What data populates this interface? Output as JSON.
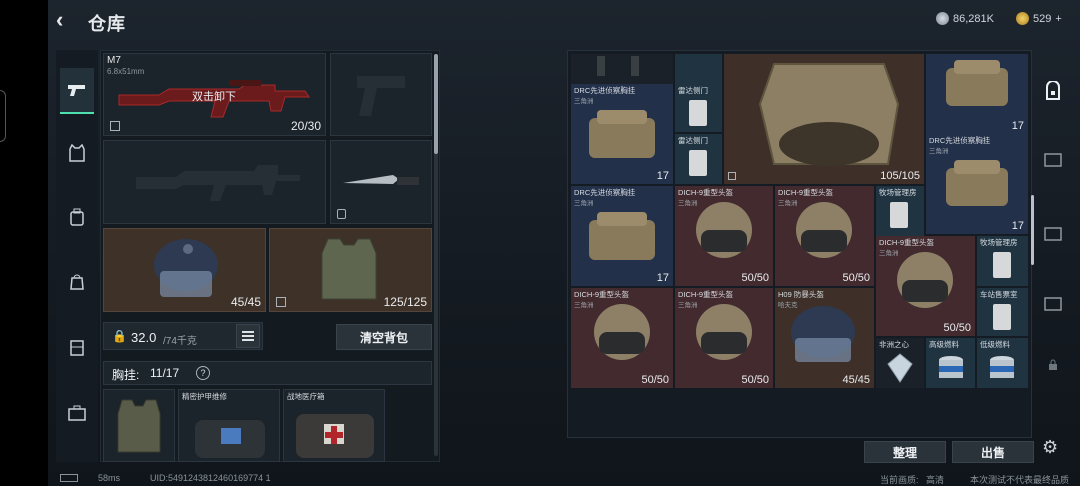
{
  "header": {
    "title": "仓库",
    "currency1": "86,281K",
    "currency2": "529",
    "plus": "+"
  },
  "loadout": {
    "primary": {
      "name": "M7",
      "ammo": "6.8x51mm",
      "action": "双击卸下",
      "count": "20/30"
    },
    "helmet": {
      "count": "45/45"
    },
    "armor": {
      "count": "125/125"
    },
    "weight": {
      "current": "32.0",
      "max": "/74千克"
    },
    "clear_button": "清空背包",
    "rig": {
      "label": "胸挂:",
      "value": "11/17",
      "help": "?"
    },
    "pouch": [
      {
        "name": "",
        "icon": "vest"
      },
      {
        "name": "精密护甲维修",
        "icon": "repair-kit"
      },
      {
        "name": "战地医疗箱",
        "icon": "medkit"
      }
    ]
  },
  "stash": {
    "items": [
      {
        "name": "DRC先进侦察胸挂",
        "sub": "三角洲",
        "qty": "17",
        "type": "bag"
      },
      {
        "name": "雷达侧门",
        "sub": "",
        "qty": "",
        "type": "card"
      },
      {
        "name": "雷达侧门",
        "sub": "",
        "qty": "",
        "type": "card"
      },
      {
        "name": "",
        "sub": "",
        "qty": "105/105",
        "type": "armor"
      },
      {
        "name": "",
        "sub": "",
        "qty": "17",
        "type": "bag"
      },
      {
        "name": "DRC先进侦察胸挂",
        "sub": "三角洲",
        "qty": "17",
        "type": "bag"
      },
      {
        "name": "DRC先进侦察胸挂",
        "sub": "三角洲",
        "qty": "17",
        "type": "bag"
      },
      {
        "name": "DICH-9重型头盔",
        "sub": "三角洲",
        "qty": "50/50",
        "type": "helmet"
      },
      {
        "name": "DICH-9重型头盔",
        "sub": "三角洲",
        "qty": "50/50",
        "type": "helmet"
      },
      {
        "name": "牧场管理房",
        "sub": "",
        "qty": "",
        "type": "card"
      },
      {
        "name": "DICH-9重型头盔",
        "sub": "三角洲",
        "qty": "50/50",
        "type": "helmet"
      },
      {
        "name": "牧场管理房",
        "sub": "",
        "qty": "",
        "type": "card"
      },
      {
        "name": "车站售票室",
        "sub": "",
        "qty": "",
        "type": "card"
      },
      {
        "name": "DICH-9重型头盔",
        "sub": "三角洲",
        "qty": "50/50",
        "type": "helmet"
      },
      {
        "name": "DICH-9重型头盔",
        "sub": "三角洲",
        "qty": "50/50",
        "type": "helmet"
      },
      {
        "name": "H09 防暴头盔",
        "sub": "哈夫克",
        "qty": "45/45",
        "type": "helmet-dark"
      },
      {
        "name": "非洲之心",
        "sub": "",
        "qty": "",
        "type": "gem"
      },
      {
        "name": "高级燃料",
        "sub": "",
        "qty": "",
        "type": "fuel"
      },
      {
        "name": "低级燃料",
        "sub": "",
        "qty": "",
        "type": "fuel"
      }
    ],
    "sort_button": "整理",
    "sell_button": "出售"
  },
  "status": {
    "ping": "58ms",
    "uid": "UID:5491243812460169774 1",
    "quality_label": "当前画质:",
    "quality": "高清",
    "notice": "本次测试不代表最终品质"
  },
  "colors": {
    "accent": "#4fe0b0",
    "blue": "#23304a",
    "red": "#432a2e",
    "brown": "#3e3029"
  }
}
